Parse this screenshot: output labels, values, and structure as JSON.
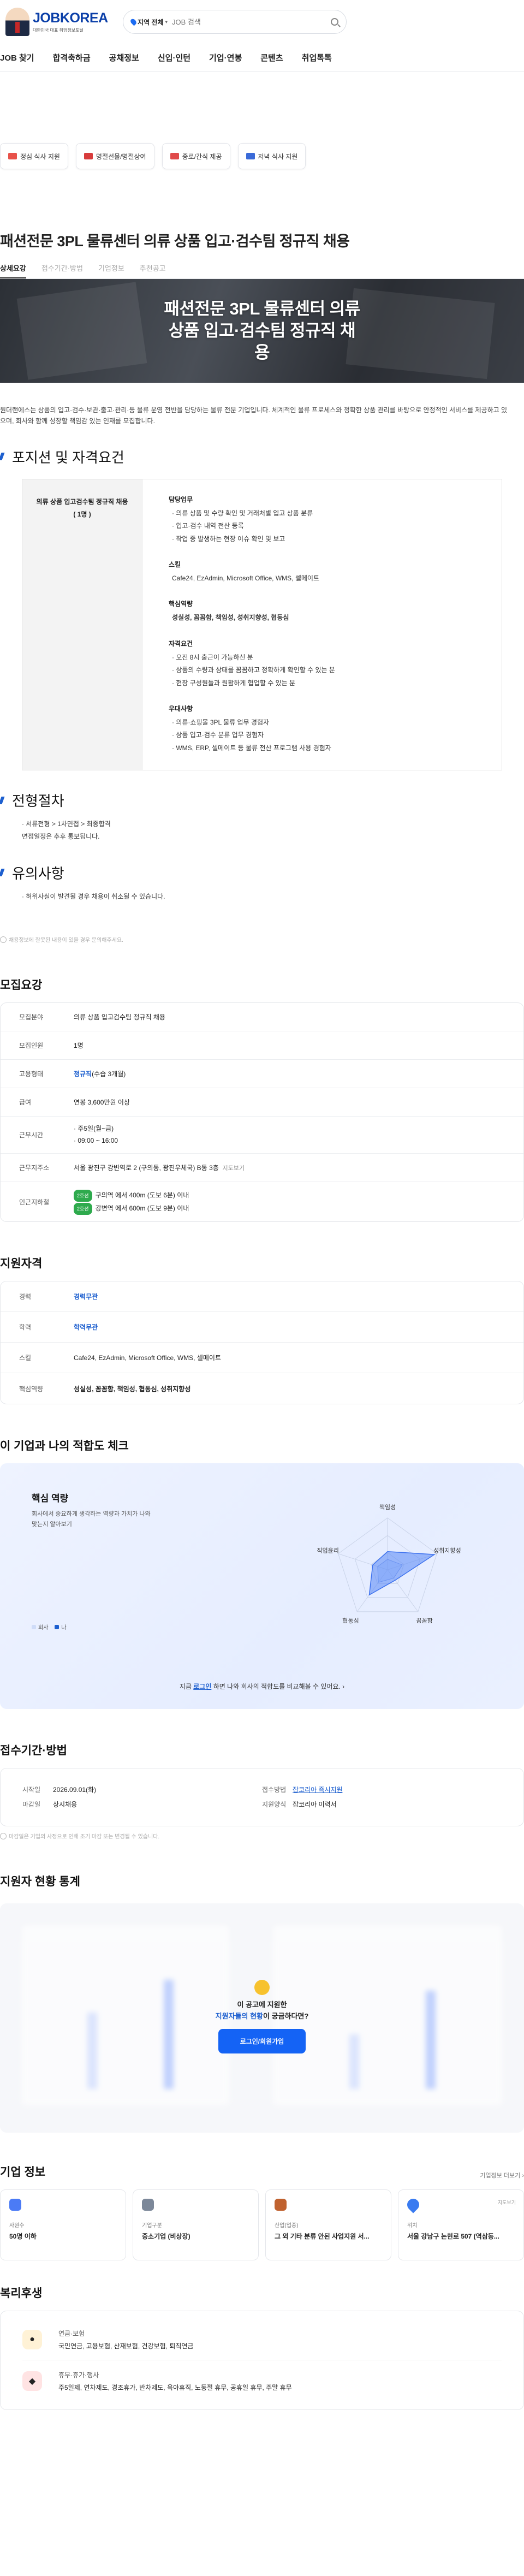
{
  "header": {
    "brand": "JOBKOREA",
    "brand_sub": "대한민국 대표 취업정보포털",
    "region_label": "지역 전체",
    "search_placeholder": "JOB 검색"
  },
  "gnb": [
    "JOB 찾기",
    "합격축하금",
    "공채정보",
    "신입·인턴",
    "기업·연봉",
    "콘텐츠",
    "취업톡톡"
  ],
  "banners": [
    {
      "label": "정심 식사 지원",
      "color": "#e8524a"
    },
    {
      "label": "명절선물/명절상여",
      "color": "#d83c3c"
    },
    {
      "label": "중로/간식 제공",
      "color": "#e04a4a"
    },
    {
      "label": "저녁 식사 지원",
      "color": "#3a6ad8"
    }
  ],
  "job": {
    "title": "패션전문 3PL 물류센터 의류 상품 입고·검수팀 정규직 채용",
    "tabs": [
      "상세요강",
      "접수기간·방법",
      "기업정보",
      "추천공고"
    ],
    "hero_text": "패션전문 3PL 물류센터 의류 상품 입고·검수팀 정규직 채용",
    "intro": "원더랜에스는 상품의 입고·검수·보관·출고·관리·등 물류 운영 전반을 담당하는 물류 전문 기업입니다. 체계적인 물류 프로세스와 정확한 상품 관리를 바탕으로 안정적인 서비스를 제공하고 있으며, 회사와 함께 성장할 책임감 있는 인재를 모집합니다."
  },
  "position": {
    "heading": "포지션 및 자격요건",
    "left_title": "의류 상품 입고검수팀 정규직 채용",
    "left_count": "( 1명 )",
    "groups": [
      {
        "title": "담당업무",
        "lines": [
          "· 의류 상품 및 수량 확인 및 거래처별 입고 상품 분류",
          "· 입고·검수 내역 전산 등록",
          "· 작업 중 발생하는 현장 이슈 확인 및 보고"
        ]
      },
      {
        "title": "스킬",
        "lines": [
          "Cafe24, EzAdmin, Microsoft Office, WMS, 셀메이트"
        ]
      },
      {
        "title": "핵심역량",
        "lines": [
          "성실성, 꼼꼼함, 책임성, 성취지향성, 협동심"
        ]
      },
      {
        "title": "자격요건",
        "lines": [
          "· 오전 8시 출근이 가능하신 분",
          "· 상품의 수량과 상태를 꼼꼼하고 정확하게 확인할 수 있는 분",
          "· 현장 구성원들과 원활하게 협업할 수 있는 분"
        ]
      },
      {
        "title": "우대사항",
        "lines": [
          "· 의류·쇼핑몰 3PL 물류 업무 경험자",
          "· 상품 입고·검수 분류 업무 경험자",
          "· WMS, ERP, 셀메이트 등 물류 전산 프로그램 사용 경험자"
        ]
      }
    ]
  },
  "process": {
    "heading": "전형절차",
    "line1": "· 서류전형 > 1차면접 > 최종합격",
    "line2": "면접일정은 추후 통보됩니다."
  },
  "notice": {
    "heading": "유의사항",
    "line1": "· 허위사실이 발견될 경우 채용이 취소될 수 있습니다."
  },
  "report_text": "채용정보에 잘못된 내용이 있을 경우 문의해주세요.",
  "recruit": {
    "title": "모집요강",
    "rows": [
      {
        "key": "모집분야",
        "val": "의류 상품 입고검수팀 정규직 채용"
      },
      {
        "key": "모집인원",
        "val": "1명"
      },
      {
        "key": "고용형태",
        "val": "정규직",
        "extra": "(수습 3개월)"
      },
      {
        "key": "급여",
        "val": "연봉 3,600만원 이상"
      },
      {
        "key": "근무시간",
        "val": "· 주5일(월~금)",
        "val2": "· 09:00 ~ 16:00"
      },
      {
        "key": "근무지주소",
        "val": "서울 광진구 강변역로 2 (구의동, 광진우체국) B동 3층",
        "extra": "지도보기"
      },
      {
        "key": "인근지하철",
        "pill1": "2호선",
        "val": "구의역 에서 400m (도보 6분) 이내",
        "pill2": "2호선",
        "val2": "강변역 에서 600m (도보 9분) 이내"
      }
    ]
  },
  "qualify": {
    "title": "지원자격",
    "rows": [
      {
        "key": "경력",
        "val": "경력무관"
      },
      {
        "key": "학력",
        "val": "학력무관"
      },
      {
        "key": "스킬",
        "val": "Cafe24, EzAdmin, Microsoft Office, WMS, 셀메이트"
      },
      {
        "key": "핵심역량",
        "val": "성실성, 꼼꼼함, 책임성, 협동심, 성취지향성"
      }
    ]
  },
  "fit": {
    "title": "이 기업과 나의 적합도 체크",
    "card_title": "핵심 역량",
    "card_desc": "회사에서 중요하게 생각하는 역량과 가치가 나와 맞는지 알아보기",
    "legend_company": "회사",
    "legend_me": "나",
    "cta_pre": "지금",
    "cta_link": "로그인",
    "cta_post": "하면 나와 회사의 적합도를 비교해볼 수 있어요.",
    "radar_labels": [
      "책임성",
      "성취지향성",
      "꼼꼼함",
      "협동심",
      "직업윤리"
    ],
    "radar_company": [
      0.35,
      0.95,
      0.25,
      0.6,
      0.3
    ],
    "radar_me": [
      0.2,
      0.3,
      0.2,
      0.3,
      0.2
    ]
  },
  "apply": {
    "title": "접수기간·방법",
    "start_key": "시작일",
    "start_val": "2026.09.01(화)",
    "end_key": "마감일",
    "end_val": "상시채용",
    "method_key": "접수방법",
    "method_val": "잡코리아 즉시지원",
    "form_key": "지원양식",
    "form_val": "잡코리아 이력서",
    "note": "마감일은 기업의 사정으로 인해 조기 마감 또는 변경될 수 있습니다."
  },
  "stats": {
    "title": "지원자 현황 통계",
    "msg1": "이 공고에 지원한",
    "msg2_highlight": "지원자들의 현황",
    "msg2_post": "이 궁금하다면?",
    "button": "로그인/회원가입"
  },
  "company": {
    "title": "기업 정보",
    "more": "기업정보 더보기",
    "tiles": [
      {
        "label": "사원수",
        "value": "50명 이하",
        "color": "#4b7bf5"
      },
      {
        "label": "기업구분",
        "value": "중소기업 (비상장)",
        "color": "#7c8899"
      },
      {
        "label": "산업(업종)",
        "value": "그 외 기타 분류 안된 사업지원 서...",
        "color": "#c0622f"
      },
      {
        "label": "위치",
        "value": "서울 강남구 논현로 507 (역삼동...",
        "color": "#3a7bf0",
        "sub": "지도보기"
      }
    ]
  },
  "welfare": {
    "title": "복리후생",
    "items": [
      {
        "name": "연금·보험",
        "desc": "국민연금, 고용보험, 산재보험, 건강보험, 퇴직연금"
      },
      {
        "name": "휴무·휴가·행사",
        "desc": "주5일제, 연차제도, 경조휴가, 반차제도, 육아휴직, 노동절 휴무, 공휴일 휴무, 주말 휴무"
      }
    ]
  }
}
